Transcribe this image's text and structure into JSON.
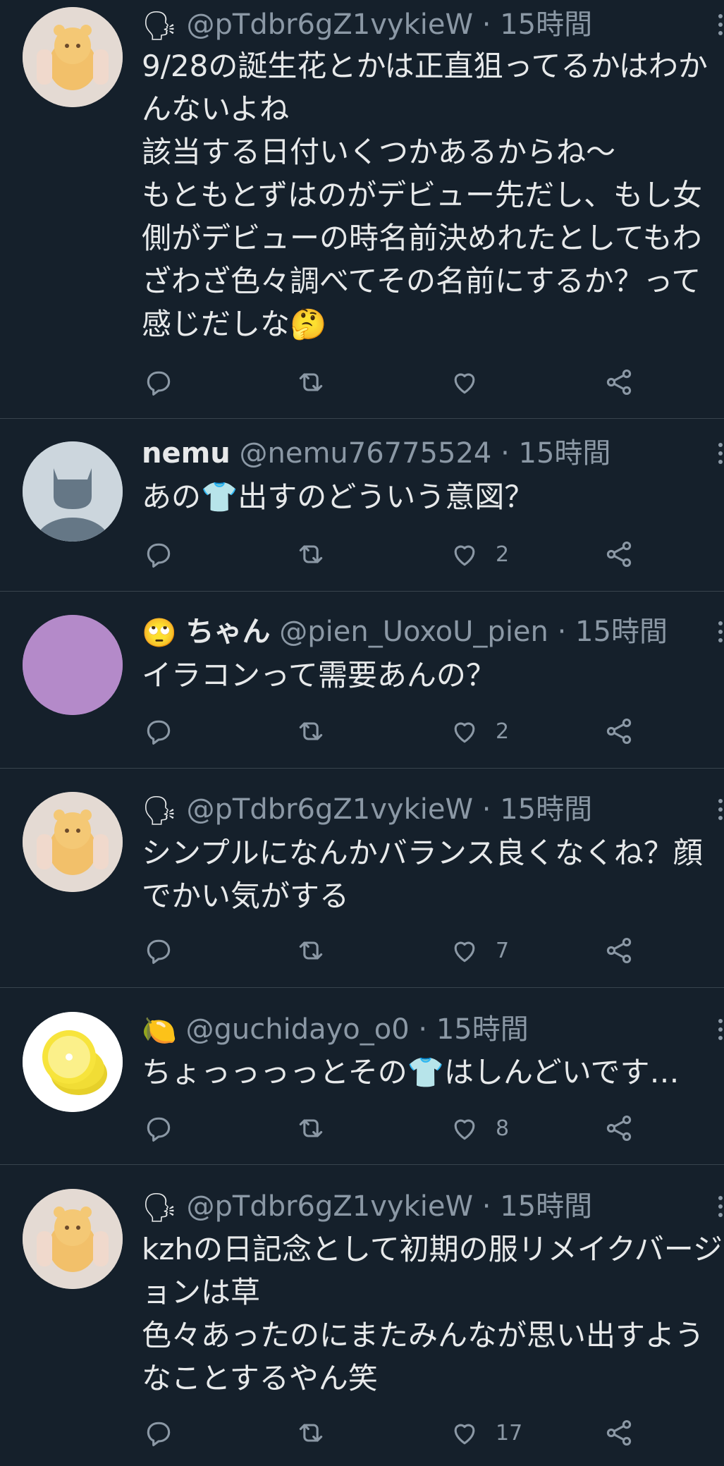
{
  "tweets": [
    {
      "name": "",
      "name_emoji": "🗣",
      "handle": "@pTdbr6gZ1vykieW",
      "sep": "·",
      "time": "15時間",
      "text": "9/28の誕生花とかは正直狙ってるかはわかんないよね\n該当する日付いくつかあるからね〜\nもともとずはのがデビュー先だし、もし女側がデビューの時名前決めれたとしてもわざわざ色々調べてその名前にするか？って感じだしな🤔",
      "reply_count": "",
      "retweet_count": "",
      "like_count": "",
      "avatar_icon": "orange-cat-plush"
    },
    {
      "name": "nemu",
      "name_emoji": "",
      "handle": "@nemu76775524",
      "sep": "·",
      "time": "15時間",
      "text": "あの👕出すのどういう意図？",
      "reply_count": "",
      "retweet_count": "",
      "like_count": "2",
      "avatar_icon": "default-cat-silhouette"
    },
    {
      "name": "ちゃん",
      "name_emoji": "🙄",
      "handle": "@pien_UoxoU_pien",
      "sep": "·",
      "time": "15時間",
      "text": "イラコンって需要あんの？",
      "reply_count": "",
      "retweet_count": "",
      "like_count": "2",
      "avatar_icon": "purple-circle"
    },
    {
      "name": "",
      "name_emoji": "🗣",
      "handle": "@pTdbr6gZ1vykieW",
      "sep": "·",
      "time": "15時間",
      "text": "シンプルになんかバランス良くなくね？顔でかい気がする",
      "reply_count": "",
      "retweet_count": "",
      "like_count": "7",
      "avatar_icon": "orange-cat-plush"
    },
    {
      "name": "",
      "name_emoji": "🍋",
      "handle": "@guchidayo_o0",
      "sep": "·",
      "time": "15時間",
      "text": "ちょっっっっとその👕はしんどいです…",
      "reply_count": "",
      "retweet_count": "",
      "like_count": "8",
      "avatar_icon": "lemon-slices"
    },
    {
      "name": "",
      "name_emoji": "🗣",
      "handle": "@pTdbr6gZ1vykieW",
      "sep": "·",
      "time": "15時間",
      "text": "kzhの日記念として初期の服リメイクバージョンは草\n色々あったのにまたみんなが思い出すようなことするやん笑",
      "reply_count": "",
      "retweet_count": "",
      "like_count": "17",
      "avatar_icon": "orange-cat-plush"
    }
  ],
  "colors": {
    "background": "#15202b",
    "text": "#e7e9ea",
    "muted": "#8b98a5",
    "divider": "#38444d"
  },
  "icons": [
    "reply-icon",
    "retweet-icon",
    "like-icon",
    "share-icon",
    "more-icon"
  ]
}
